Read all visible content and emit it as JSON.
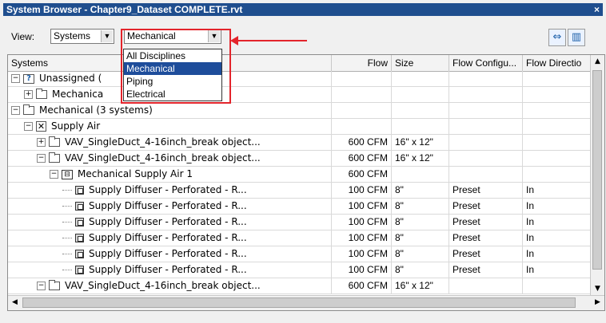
{
  "window": {
    "title": "System Browser - Chapter9_Dataset COMPLETE.rvt",
    "close_glyph": "×"
  },
  "toolbar": {
    "view_label": "View:",
    "view_combo_value": "Systems",
    "discipline_combo_value": "Mechanical",
    "combo_arrow": "▼"
  },
  "dropdown": {
    "options": [
      "All Disciplines",
      "Mechanical",
      "Piping",
      "Electrical"
    ],
    "selected_index": 1
  },
  "columns": [
    "Systems",
    "Flow",
    "Size",
    "Flow Configu...",
    "Flow Directio"
  ],
  "rows": [
    {
      "depth": 0,
      "exp": "−",
      "icon": "question-folder-icon",
      "name": "Unassigned (",
      "flow": "",
      "size": "",
      "config": "",
      "dir": ""
    },
    {
      "depth": 1,
      "exp": "+",
      "icon": "folder-icon",
      "name": "Mechanica",
      "flow": "",
      "size": "",
      "config": "",
      "dir": ""
    },
    {
      "depth": 0,
      "exp": "−",
      "icon": "folder-icon",
      "name": "Mechanical (3 systems)",
      "flow": "",
      "size": "",
      "config": "",
      "dir": ""
    },
    {
      "depth": 1,
      "exp": "−",
      "icon": "supply-air-x-icon",
      "name": "Supply Air",
      "flow": "",
      "size": "",
      "config": "",
      "dir": ""
    },
    {
      "depth": 2,
      "exp": "+",
      "icon": "folder-icon",
      "name": "VAV_SingleDuct_4-16inch_break object...",
      "flow": "600 CFM",
      "size": "16\" x 12\"",
      "config": "",
      "dir": ""
    },
    {
      "depth": 2,
      "exp": "−",
      "icon": "folder-icon",
      "name": "VAV_SingleDuct_4-16inch_break object...",
      "flow": "600 CFM",
      "size": "16\" x 12\"",
      "config": "",
      "dir": ""
    },
    {
      "depth": 3,
      "exp": "−",
      "icon": "mechanical-system-icon",
      "name": "Mechanical Supply Air 1",
      "flow": "600 CFM",
      "size": "",
      "config": "",
      "dir": ""
    },
    {
      "depth": 4,
      "exp": "",
      "icon": "diffuser-icon",
      "name": "Supply Diffuser - Perforated - R...",
      "flow": "100 CFM",
      "size": "8\"",
      "config": "Preset",
      "dir": "In"
    },
    {
      "depth": 4,
      "exp": "",
      "icon": "diffuser-icon",
      "name": "Supply Diffuser - Perforated - R...",
      "flow": "100 CFM",
      "size": "8\"",
      "config": "Preset",
      "dir": "In"
    },
    {
      "depth": 4,
      "exp": "",
      "icon": "diffuser-icon",
      "name": "Supply Diffuser - Perforated - R...",
      "flow": "100 CFM",
      "size": "8\"",
      "config": "Preset",
      "dir": "In"
    },
    {
      "depth": 4,
      "exp": "",
      "icon": "diffuser-icon",
      "name": "Supply Diffuser - Perforated - R...",
      "flow": "100 CFM",
      "size": "8\"",
      "config": "Preset",
      "dir": "In"
    },
    {
      "depth": 4,
      "exp": "",
      "icon": "diffuser-icon",
      "name": "Supply Diffuser - Perforated - R...",
      "flow": "100 CFM",
      "size": "8\"",
      "config": "Preset",
      "dir": "In"
    },
    {
      "depth": 4,
      "exp": "",
      "icon": "diffuser-icon",
      "name": "Supply Diffuser - Perforated - R...",
      "flow": "100 CFM",
      "size": "8\"",
      "config": "Preset",
      "dir": "In"
    },
    {
      "depth": 2,
      "exp": "−",
      "icon": "folder-icon",
      "name": "VAV_SingleDuct_4-16inch_break object...",
      "flow": "600 CFM",
      "size": "16\" x 12\"",
      "config": "",
      "dir": ""
    }
  ],
  "scroll": {
    "up": "▲",
    "down": "▼",
    "left": "◀",
    "right": "▶"
  },
  "colors": {
    "accent_red": "#e3242b",
    "title_blue": "#1f4e8e",
    "selection_blue": "#1e4d9b"
  }
}
